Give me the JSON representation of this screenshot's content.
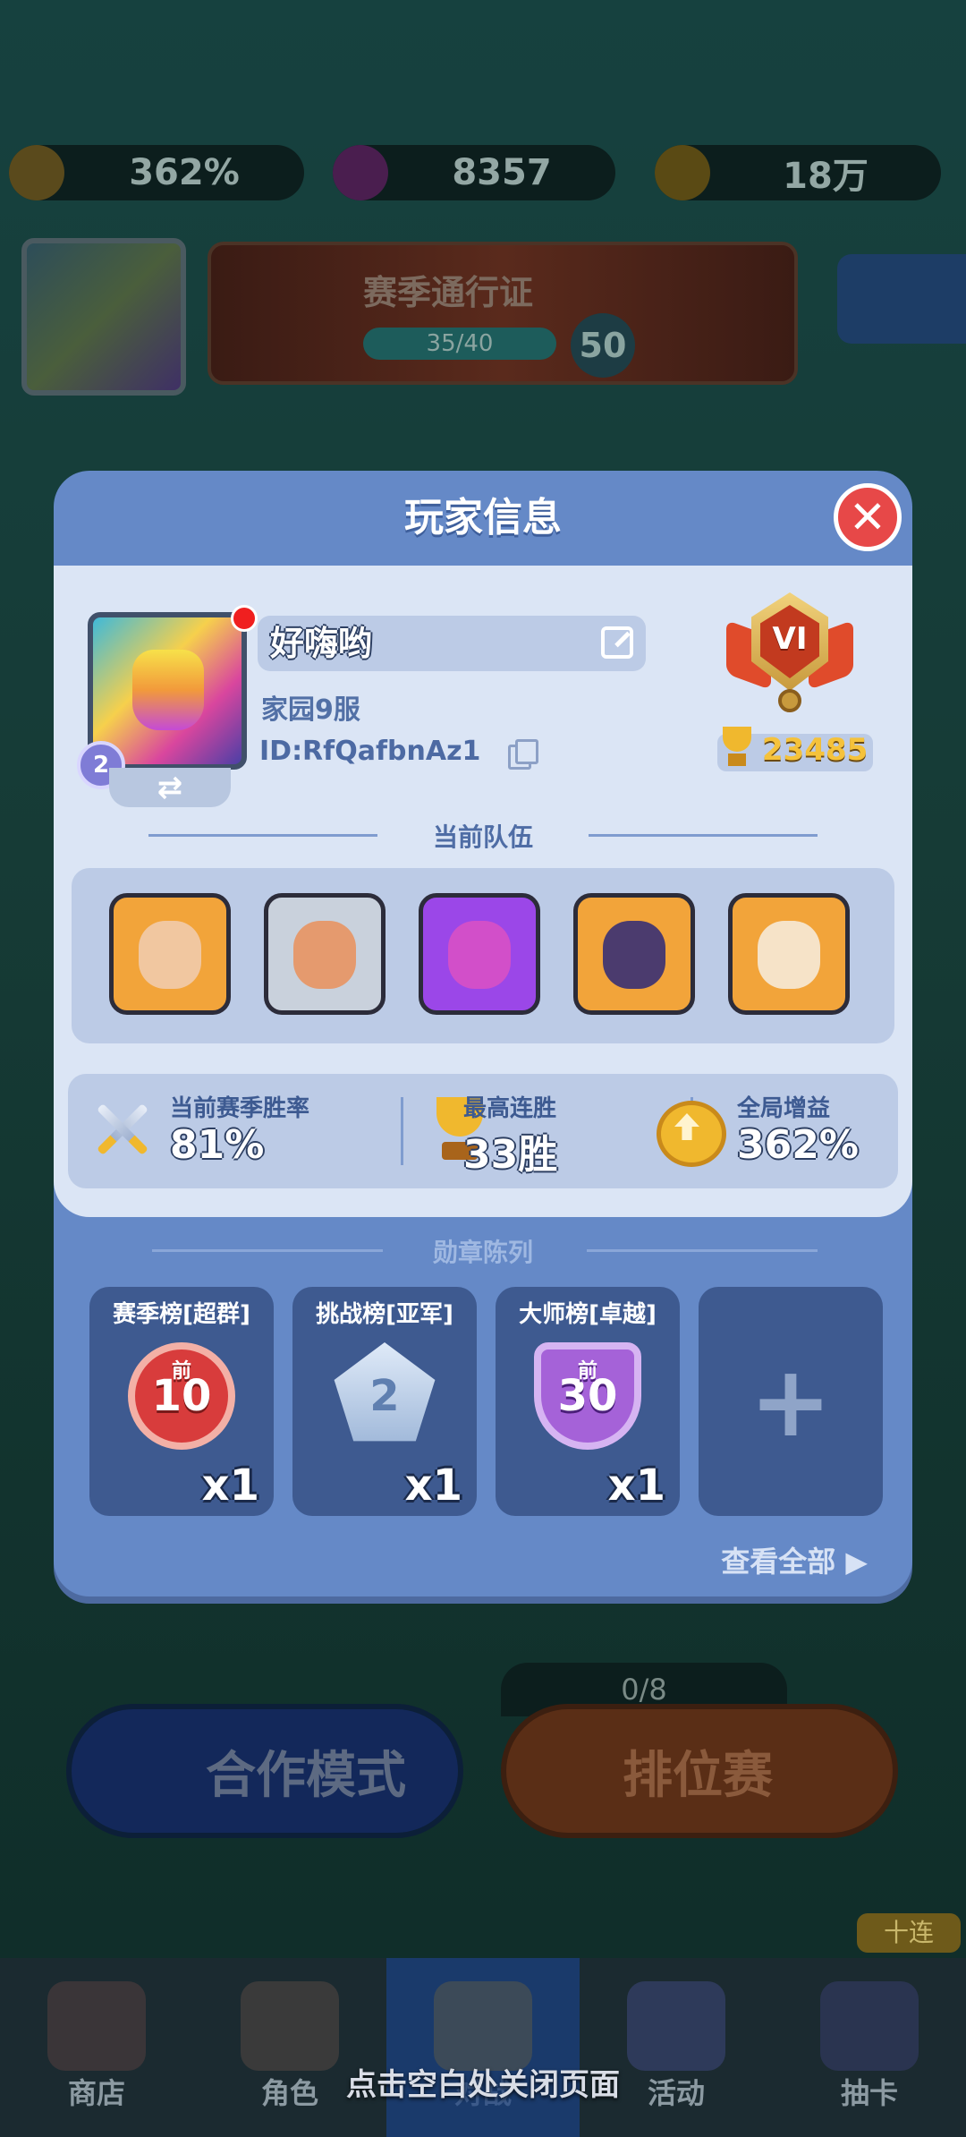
{
  "background": {
    "resources": {
      "boost_percent": "362%",
      "gems": "8357",
      "gold": "18万"
    },
    "season_pass": {
      "title": "赛季通行证",
      "progress": "35/40",
      "level": "50"
    },
    "modes": {
      "coop_label": "合作模式",
      "ranked_label": "排位赛",
      "ranked_counter": "0/8"
    },
    "bottom_nav": [
      {
        "label": "商店"
      },
      {
        "label": "角色"
      },
      {
        "label": "对战"
      },
      {
        "label": "活动"
      },
      {
        "label": "抽卡"
      }
    ],
    "ten_pull_badge": "十连"
  },
  "modal": {
    "title": "玩家信息",
    "player": {
      "name": "好嗨哟",
      "server": "家园9服",
      "id": "ID:RfQafbnAz1",
      "avatar_level": "2",
      "rank_roman": "VI",
      "trophies": "23485"
    },
    "team_section_title": "当前队伍",
    "team": [
      {
        "name": "hero-golden-king",
        "bg": "#f2a43a"
      },
      {
        "name": "hero-barbarian",
        "bg": "#c9d1dc"
      },
      {
        "name": "hero-purple-brute",
        "bg": "#9b47e8"
      },
      {
        "name": "hero-dark-knight",
        "bg": "#f2a43a"
      },
      {
        "name": "hero-angel",
        "bg": "#f2a43a"
      }
    ],
    "stats": {
      "win_rate_label": "当前赛季胜率",
      "win_rate_value": "81%",
      "max_streak_label": "最高连胜",
      "max_streak_value": "33胜",
      "global_boost_label": "全局增益",
      "global_boost_value": "362%"
    },
    "medals_section_title": "勋章陈列",
    "medals": [
      {
        "title": "赛季榜[超群]",
        "badge_top": "前",
        "badge_text": "10",
        "count": "x1"
      },
      {
        "title": "挑战榜[亚军]",
        "badge_text": "2",
        "count": "x1"
      },
      {
        "title": "大师榜[卓越]",
        "badge_top": "前",
        "badge_text": "30",
        "count": "x1"
      }
    ],
    "add_medal_symbol": "+",
    "view_all": "查看全部 ▶"
  },
  "close_hint": "点击空白处关闭页面"
}
